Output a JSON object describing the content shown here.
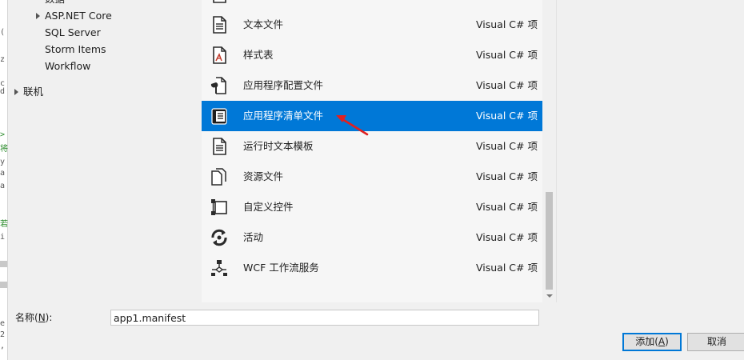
{
  "tree": {
    "items": [
      {
        "label": "数据",
        "arrow": false
      },
      {
        "label": "ASP.NET Core",
        "arrow": true
      },
      {
        "label": "SQL Server",
        "arrow": false
      },
      {
        "label": "Storm Items",
        "arrow": false
      },
      {
        "label": "Workflow",
        "arrow": false
      },
      {
        "label": "联机",
        "arrow": true
      }
    ]
  },
  "list": {
    "items": [
      {
        "name": "文本文件",
        "kind": "Visual C# 项",
        "icon": "text-file-icon"
      },
      {
        "name": "样式表",
        "kind": "Visual C# 项",
        "icon": "stylesheet-icon"
      },
      {
        "name": "应用程序配置文件",
        "kind": "Visual C# 项",
        "icon": "app-config-icon"
      },
      {
        "name": "应用程序清单文件",
        "kind": "Visual C# 项",
        "icon": "manifest-icon",
        "selected": true
      },
      {
        "name": "运行时文本模板",
        "kind": "Visual C# 项",
        "icon": "text-template-icon"
      },
      {
        "name": "资源文件",
        "kind": "Visual C# 项",
        "icon": "resource-file-icon"
      },
      {
        "name": "自定义控件",
        "kind": "Visual C# 项",
        "icon": "custom-control-icon"
      },
      {
        "name": "活动",
        "kind": "Visual C# 项",
        "icon": "activity-icon"
      },
      {
        "name": "WCF 工作流服务",
        "kind": "Visual C# 项",
        "icon": "wcf-workflow-icon"
      }
    ]
  },
  "form": {
    "name_label_prefix": "名称(",
    "name_label_key": "N",
    "name_label_suffix": "):",
    "name_value": "app1.manifest"
  },
  "buttons": {
    "add_prefix": "添加(",
    "add_key": "A",
    "add_suffix": ")",
    "cancel": "取消"
  },
  "colors": {
    "selection": "#0078d7",
    "annotation_arrow": "#e02020"
  }
}
